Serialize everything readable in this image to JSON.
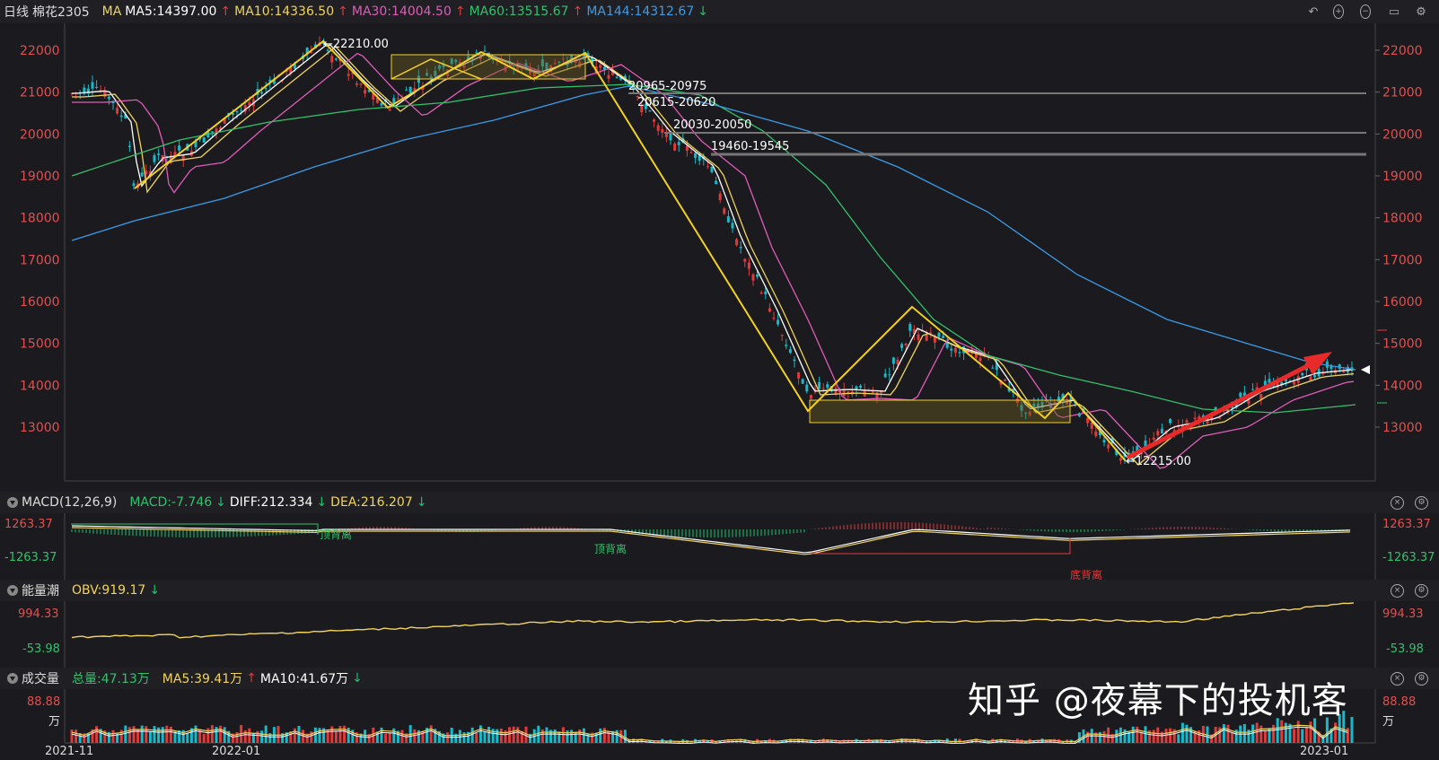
{
  "header": {
    "period": "日线",
    "symbol": "棉花2305",
    "ma_label": "MA",
    "ma5": "MA5:14397.00",
    "ma10": "MA10:14336.50",
    "ma30": "MA30:14004.50",
    "ma60": "MA60:13515.67",
    "ma144": "MA144:14312.67",
    "arrow_up": "↑",
    "arrow_down": "↓"
  },
  "colors": {
    "ma5": "#ffffff",
    "ma10": "#f2d35c",
    "ma30": "#e05bb8",
    "ma60": "#33c06b",
    "ma144": "#3a9be8",
    "up": "#e03b3b",
    "down": "#19b9c9",
    "zigzag": "#f2d025"
  },
  "price_axis": {
    "ticks": [
      "22000",
      "21000",
      "20000",
      "19000",
      "18000",
      "17000",
      "16000",
      "15000",
      "14000",
      "13000"
    ]
  },
  "annotations": {
    "high": "←22210.00",
    "low": "←12215.00",
    "level1": "20965-20975",
    "level2": "20615-20620",
    "level3": "20030-20050",
    "level4": "19460-19545"
  },
  "macd": {
    "title": "MACD(12,26,9)",
    "macd": "MACD:-7.746",
    "diff": "DIFF:212.334",
    "dea": "DEA:216.207",
    "top": "1263.37",
    "bottom": "-1263.37",
    "label_top_div1": "顶背离",
    "label_top_div2": "顶背离",
    "label_bottom_div": "底背离"
  },
  "obv": {
    "title": "能量潮",
    "value": "OBV:919.17",
    "top": "994.33",
    "bottom": "-53.98"
  },
  "volume": {
    "title": "成交量",
    "total": "总量:47.13万",
    "ma5": "MA5:39.41万",
    "ma10": "MA10:41.67万",
    "top": "88.88",
    "unit": "万"
  },
  "dates": [
    "2021-11",
    "2022-01",
    "2023-01"
  ],
  "watermark": "知乎 @夜幕下的投机客"
}
